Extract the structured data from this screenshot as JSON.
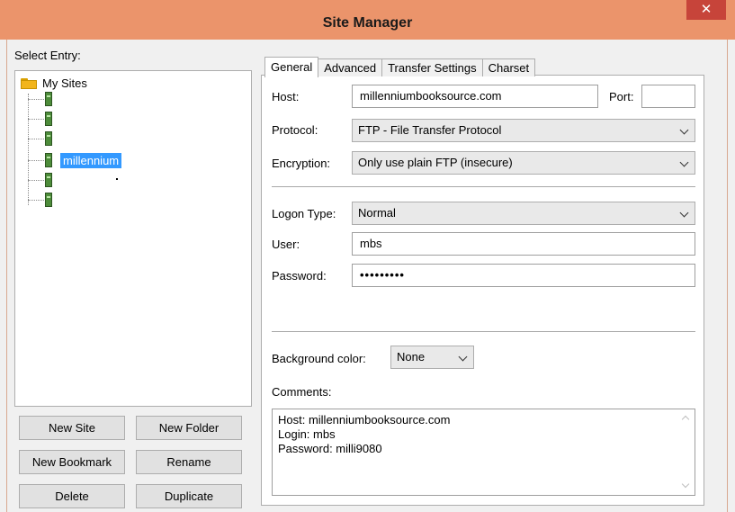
{
  "window": {
    "title": "Site Manager",
    "close_symbol": "✕"
  },
  "left": {
    "select_entry_label": "Select Entry:",
    "root_label": "My Sites",
    "sites": [
      "",
      "",
      "",
      "millennium",
      "",
      ""
    ],
    "selected_site": "millennium"
  },
  "buttons": {
    "new_site": "New Site",
    "new_folder": "New Folder",
    "new_bookmark": "New Bookmark",
    "rename": "Rename",
    "delete": "Delete",
    "duplicate": "Duplicate"
  },
  "tabs": [
    "General",
    "Advanced",
    "Transfer Settings",
    "Charset"
  ],
  "active_tab": "General",
  "general": {
    "host_label": "Host:",
    "host_value": "millenniumbooksource.com",
    "port_label": "Port:",
    "port_value": "",
    "protocol_label": "Protocol:",
    "protocol_value": "FTP - File Transfer Protocol",
    "encryption_label": "Encryption:",
    "encryption_value": "Only use plain FTP (insecure)",
    "logon_type_label": "Logon Type:",
    "logon_type_value": "Normal",
    "user_label": "User:",
    "user_value": "mbs",
    "password_label": "Password:",
    "password_value": "•••••••••",
    "bg_color_label": "Background color:",
    "bg_color_value": "None",
    "comments_label": "Comments:",
    "comments_lines": [
      "Host: millenniumbooksource.com",
      "Login: mbs",
      "Password: milli9080"
    ]
  },
  "colors": {
    "titlebar": "#eb946b",
    "close_button": "#c7443a",
    "selection": "#3399ff"
  }
}
